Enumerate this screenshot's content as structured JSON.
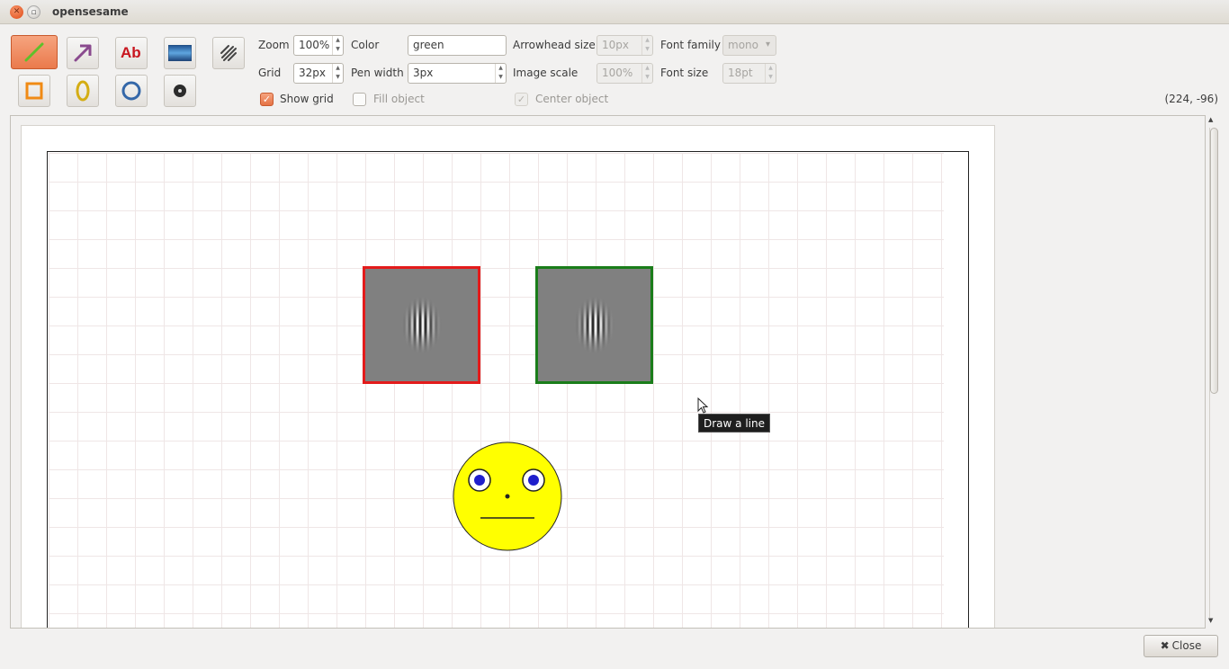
{
  "window": {
    "title": "opensesame"
  },
  "toolbar": {
    "text_tool_label": "Ab",
    "zoom": {
      "label": "Zoom",
      "value": "100%"
    },
    "grid": {
      "label": "Grid",
      "value": "32px"
    },
    "color": {
      "label": "Color",
      "value": "green"
    },
    "pen_width": {
      "label": "Pen width",
      "value": "3px"
    },
    "arrowhead_size": {
      "label": "Arrowhead size",
      "value": "10px"
    },
    "image_scale": {
      "label": "Image scale",
      "value": "100%"
    },
    "font_family": {
      "label": "Font family",
      "value": "mono"
    },
    "font_size": {
      "label": "Font size",
      "value": "18pt"
    },
    "show_grid": {
      "label": "Show grid",
      "checked": true
    },
    "fill_object": {
      "label": "Fill object",
      "checked": false
    },
    "center_object": {
      "label": "Center object",
      "checked": true
    }
  },
  "coordinates": "(224, -96)",
  "tooltip": "Draw a line",
  "footer": {
    "close_label": "Close"
  },
  "colors": {
    "accent": "#ea7a4c",
    "red_frame": "#e31b1b",
    "green_frame": "#1a7d1a",
    "face_fill": "#ffff00",
    "eye_fill": "#1e1ecc"
  }
}
